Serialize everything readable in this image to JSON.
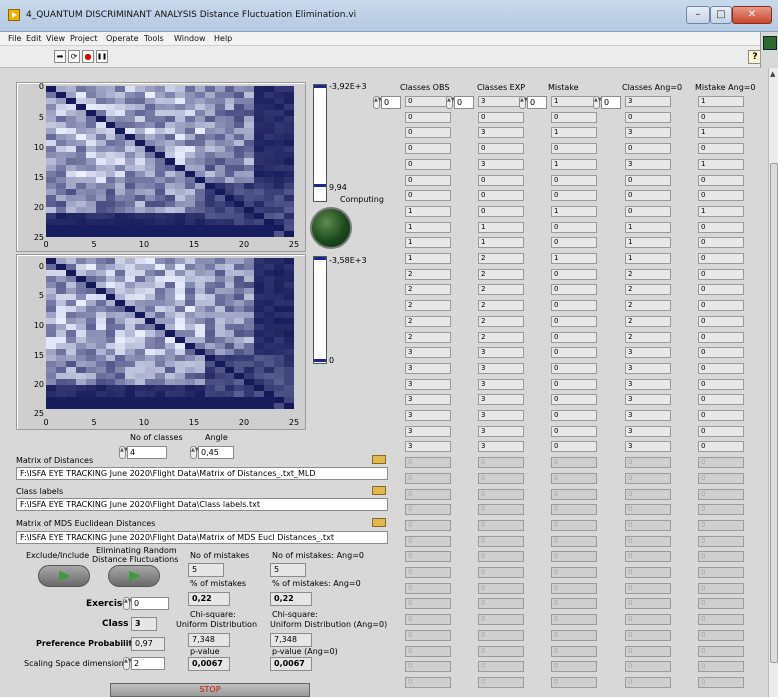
{
  "window": {
    "title": "4_QUANTUM DISCRIMINANT ANALYSIS Distance Fluctuation Elimination.vi",
    "minimize": "–",
    "maximize": "□",
    "close": "✕"
  },
  "menu": [
    "File",
    "Edit",
    "View",
    "Project",
    "Operate",
    "Tools",
    "Window",
    "Help"
  ],
  "toolbar": {
    "run": "➡",
    "run_continuous": "⟳",
    "abort": "●",
    "pause": "❚❚",
    "help": "?"
  },
  "graph1": {
    "ramp_max": "-3,92E+3",
    "ramp_min": "9,94"
  },
  "graph2": {
    "ramp_max": "-3,58E+3",
    "ramp_min": "0"
  },
  "axis_ticks": {
    "y": [
      "0",
      "5",
      "10",
      "15",
      "20",
      "25"
    ],
    "x": [
      "0",
      "5",
      "10",
      "15",
      "20",
      "25"
    ]
  },
  "computing_label": "Computing",
  "controls": {
    "no_of_classes_label": "No of classes",
    "no_of_classes": "4",
    "angle_label": "Angle",
    "angle": "0,45",
    "matrix_label": "Matrix of Distances",
    "matrix_path": "F:\\ISFA EYE TRACKING June 2020\\Flight Data\\Matrix of Distances_.txt_MLD",
    "class_labels_label": "Class labels",
    "class_labels_path": "F:\\ISFA EYE TRACKING June 2020\\Flight Data\\Class labels.txt",
    "mds_label": "Matrix of MDS Euclidean Distances",
    "mds_path": "F:\\ISFA EYE TRACKING June 2020\\Flight Data\\Matrix of MDS Eucl Distances_.txt",
    "exclude_label": "Exclude/Include",
    "eliminating_label_1": "Eliminating Random",
    "eliminating_label_2": "Distance Fluctuations",
    "exercise_label": "Exercise",
    "exercise": "0",
    "class_label": "Class",
    "class": "3",
    "pref_label": "Preference Probability",
    "pref": "0,97",
    "scaling_label": "Scaling Space dimension",
    "scaling": "2",
    "stop": "STOP"
  },
  "results": {
    "mistakes_label": "No of mistakes",
    "mistakes": "5",
    "mistakes_ang_label": "No of mistakes: Ang=0",
    "mistakes_ang": "5",
    "pct_label": "% of mistakes",
    "pct": "0,22",
    "pct_ang_label": "% of mistakes: Ang=0",
    "pct_ang": "0,22",
    "chi_label_1": "Chi-square:",
    "chi_label_2": "Uniform Distribution",
    "chi": "7,348",
    "chi_ang_label_1": "Chi-square:",
    "chi_ang_label_2": "Uniform Distribution (Ang=0)",
    "chi_ang": "7,348",
    "p_label": "p-value",
    "p": "0,0067",
    "p_ang_label": "p-value (Ang=0)",
    "p_ang": "0,0067"
  },
  "columns": [
    {
      "header": "Classes OBS",
      "index": "0",
      "values": [
        "0",
        "0",
        "0",
        "0",
        "0",
        "0",
        "0",
        "1",
        "1",
        "1",
        "1",
        "2",
        "2",
        "2",
        "2",
        "2",
        "3",
        "3",
        "3",
        "3",
        "3",
        "3",
        "3"
      ]
    },
    {
      "header": "Classes EXP",
      "index": "0",
      "values": [
        "3",
        "0",
        "3",
        "0",
        "3",
        "0",
        "0",
        "0",
        "1",
        "1",
        "2",
        "2",
        "2",
        "2",
        "2",
        "2",
        "3",
        "3",
        "3",
        "3",
        "3",
        "3",
        "3"
      ]
    },
    {
      "header": "Mistake",
      "index": "0",
      "values": [
        "1",
        "0",
        "1",
        "0",
        "1",
        "0",
        "0",
        "1",
        "0",
        "0",
        "1",
        "0",
        "0",
        "0",
        "0",
        "0",
        "0",
        "0",
        "0",
        "0",
        "0",
        "0",
        "0"
      ]
    },
    {
      "header": "Classes Ang=0",
      "index": "0",
      "values": [
        "3",
        "0",
        "3",
        "0",
        "3",
        "0",
        "0",
        "0",
        "1",
        "1",
        "1",
        "2",
        "2",
        "2",
        "2",
        "2",
        "3",
        "3",
        "3",
        "3",
        "3",
        "3",
        "3"
      ]
    },
    {
      "header": "Mistake Ang=0",
      "index": "",
      "values": [
        "1",
        "0",
        "1",
        "0",
        "1",
        "0",
        "0",
        "1",
        "0",
        "0",
        "0",
        "0",
        "0",
        "0",
        "0",
        "0",
        "0",
        "0",
        "0",
        "0",
        "0",
        "0",
        "0"
      ]
    }
  ],
  "empty_cell_value": "0"
}
